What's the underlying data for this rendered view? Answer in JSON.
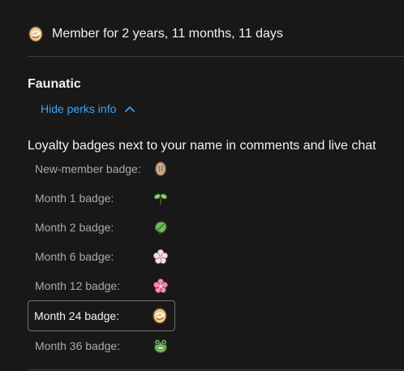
{
  "membership": {
    "duration_text": "Member for 2 years, 11 months, 11 days",
    "current_badge_icon": "month-24-badge-icon"
  },
  "tier": {
    "name": "Faunatic",
    "toggle_label": "Hide perks info",
    "toggle_icon": "chevron-up-icon"
  },
  "perk": {
    "title": "Loyalty badges next to your name in comments and live chat",
    "badges": [
      {
        "label": "New-member badge:",
        "icon": "egg-icon"
      },
      {
        "label": "Month 1 badge:",
        "icon": "sprout-icon"
      },
      {
        "label": "Month 2 badge:",
        "icon": "leaf-icon"
      },
      {
        "label": "Month 6 badge:",
        "icon": "white-flower-icon"
      },
      {
        "label": "Month 12 badge:",
        "icon": "pink-flower-icon"
      },
      {
        "label": "Month 24 badge:",
        "icon": "swirl-egg-icon",
        "selected": true
      },
      {
        "label": "Month 36 badge:",
        "icon": "frog-icon"
      }
    ]
  },
  "colors": {
    "background": "#181818",
    "link": "#3ea6ff",
    "text_primary": "#f1f1f1",
    "text_secondary": "#aaaaaa",
    "divider": "#3f3f3f"
  }
}
